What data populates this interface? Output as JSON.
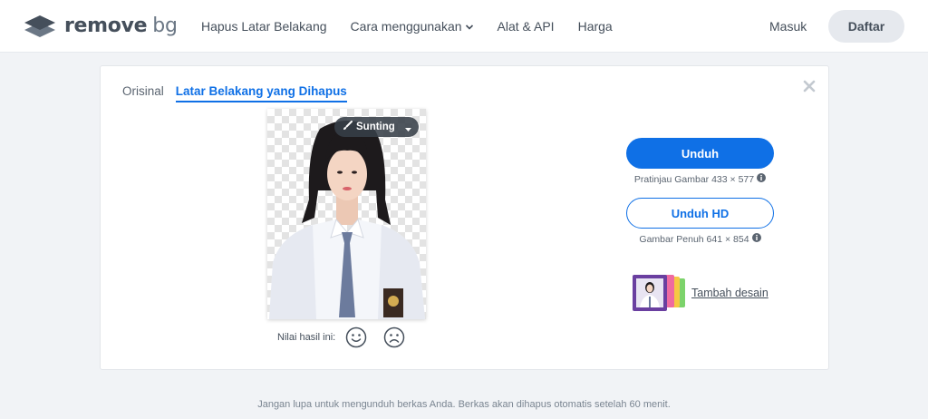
{
  "header": {
    "logo_main": "remove",
    "logo_accent": "bg",
    "nav": [
      {
        "label": "Hapus Latar Belakang"
      },
      {
        "label": "Cara menggunakan",
        "dropdown": true
      },
      {
        "label": "Alat & API"
      },
      {
        "label": "Harga"
      }
    ],
    "signin_label": "Masuk",
    "signup_label": "Daftar"
  },
  "result": {
    "tabs": [
      {
        "label": "Orisinal",
        "active": false
      },
      {
        "label": "Latar Belakang yang Dihapus",
        "active": true
      }
    ],
    "edit_label": "Sunting",
    "rating_label": "Nilai hasil ini:",
    "download_label": "Unduh",
    "download_info": "Pratinjau Gambar 433 × 577",
    "download_hd_label": "Unduh HD",
    "download_hd_info": "Gambar Penuh 641 × 854",
    "add_design_label": "Tambah desain"
  },
  "footer_note": "Jangan lupa untuk mengunduh berkas Anda. Berkas akan dihapus otomatis setelah 60 menit.",
  "colors": {
    "accent": "#0f70e6",
    "text": "#454f5b",
    "page_bg": "#f1f3f6",
    "button_grey": "#e6e9ee"
  },
  "icons": [
    "logo-layers-icon",
    "chevron-down-icon",
    "close-icon",
    "brush-icon",
    "caret-down-icon",
    "smile-icon",
    "frown-icon",
    "info-icon"
  ]
}
